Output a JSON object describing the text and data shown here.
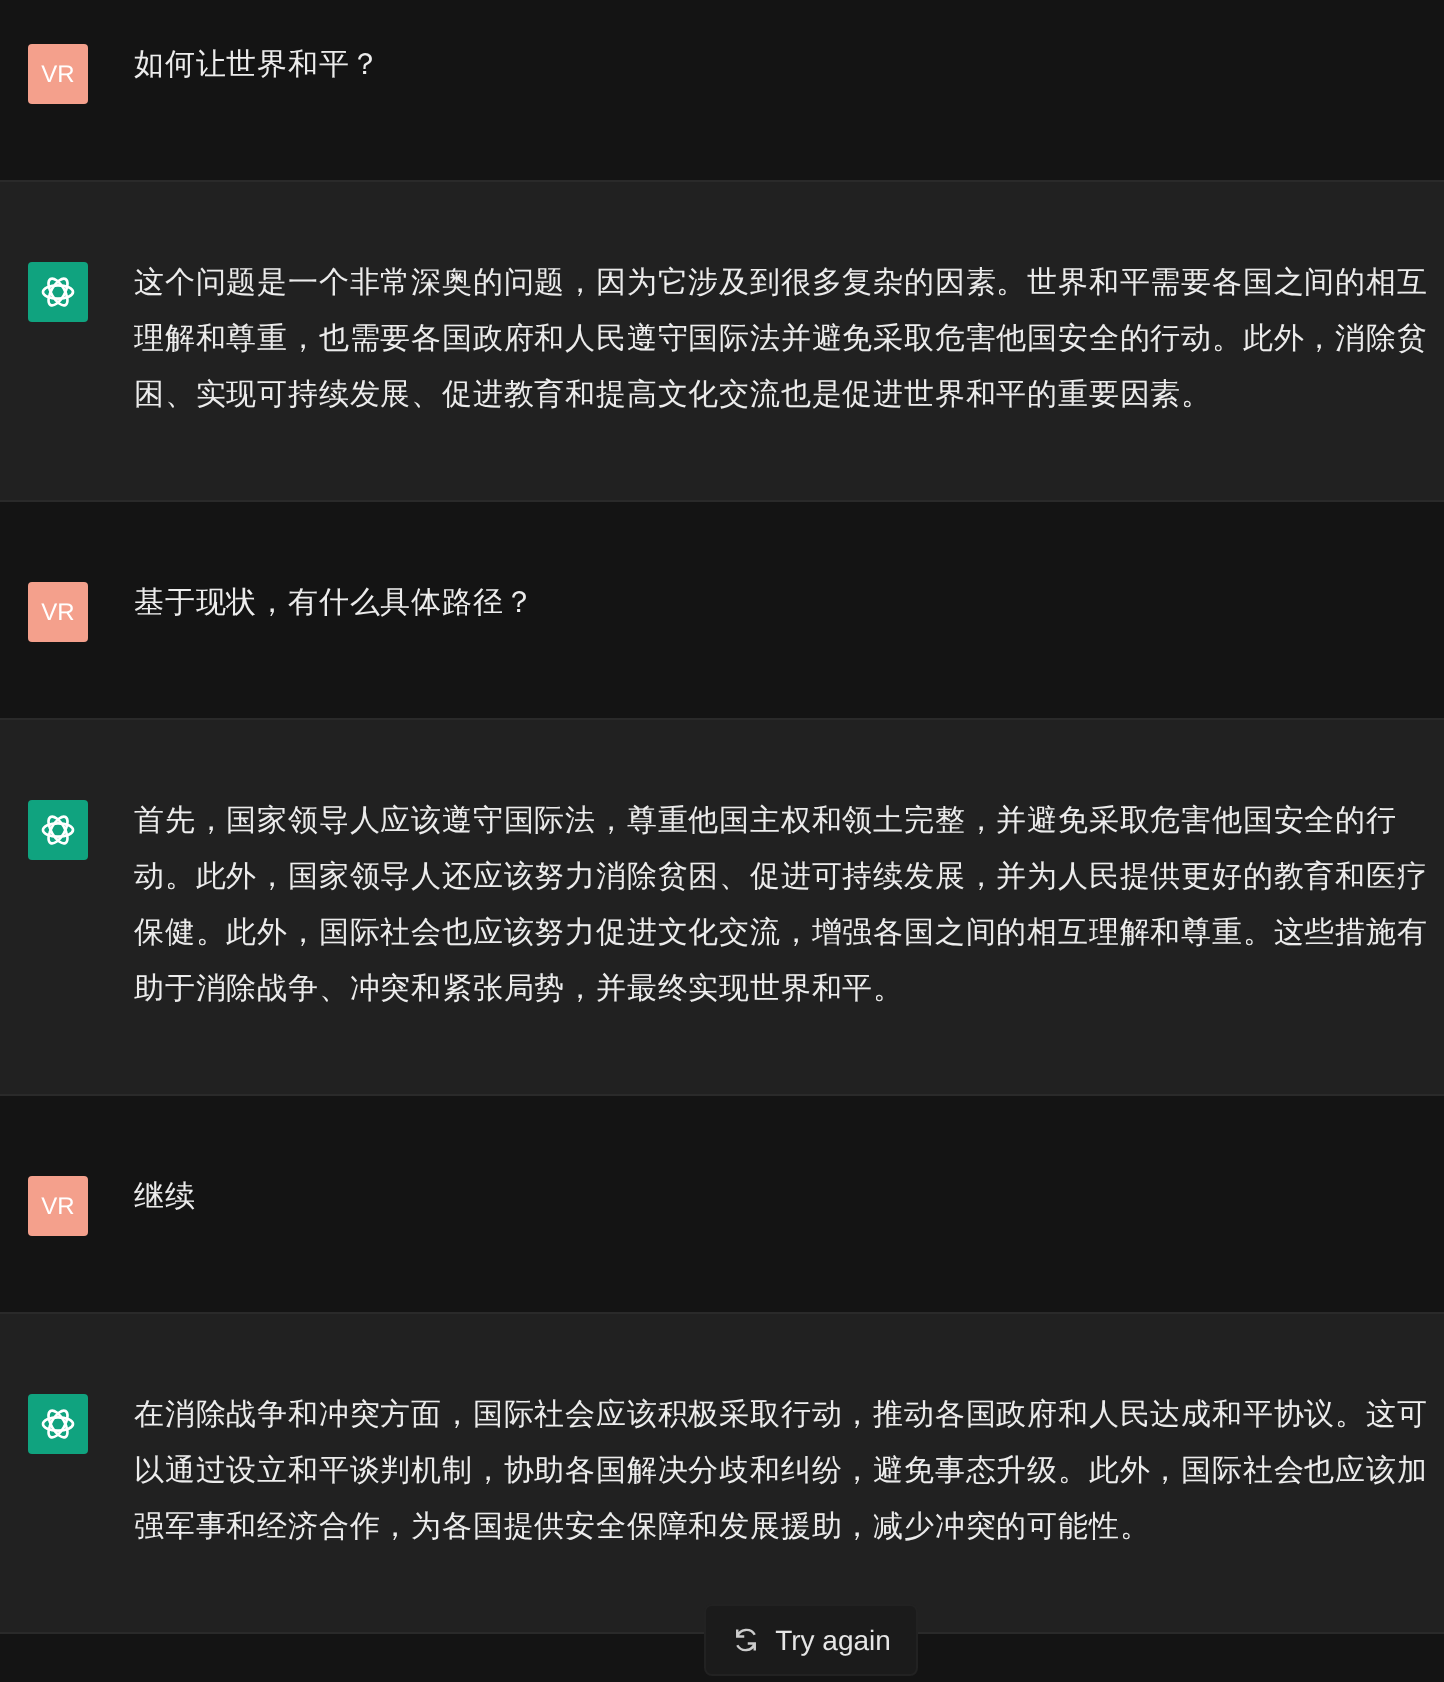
{
  "messages": [
    {
      "kind": "user",
      "avatar": "VR",
      "text": "如何让世界和平？"
    },
    {
      "kind": "assistant",
      "text": "这个问题是一个非常深奥的问题，因为它涉及到很多复杂的因素。世界和平需要各国之间的相互理解和尊重，也需要各国政府和人民遵守国际法并避免采取危害他国安全的行动。此外，消除贫困、实现可持续发展、促进教育和提高文化交流也是促进世界和平的重要因素。"
    },
    {
      "kind": "user",
      "avatar": "VR",
      "text": "基于现状，有什么具体路径？"
    },
    {
      "kind": "assistant",
      "text": "首先，国家领导人应该遵守国际法，尊重他国主权和领土完整，并避免采取危害他国安全的行动。此外，国家领导人还应该努力消除贫困、促进可持续发展，并为人民提供更好的教育和医疗保健。此外，国际社会也应该努力促进文化交流，增强各国之间的相互理解和尊重。这些措施有助于消除战争、冲突和紧张局势，并最终实现世界和平。"
    },
    {
      "kind": "user",
      "avatar": "VR",
      "text": "继续"
    },
    {
      "kind": "assistant",
      "text": "在消除战争和冲突方面，国际社会应该积极采取行动，推动各国政府和人民达成和平协议。这可以通过设立和平谈判机制，协助各国解决分歧和纠纷，避免事态升级。此外，国际社会也应该加强军事和经济合作，为各国提供安全保障和发展援助，减少冲突的可能性。"
    }
  ],
  "try_again": {
    "label": "Try again"
  }
}
